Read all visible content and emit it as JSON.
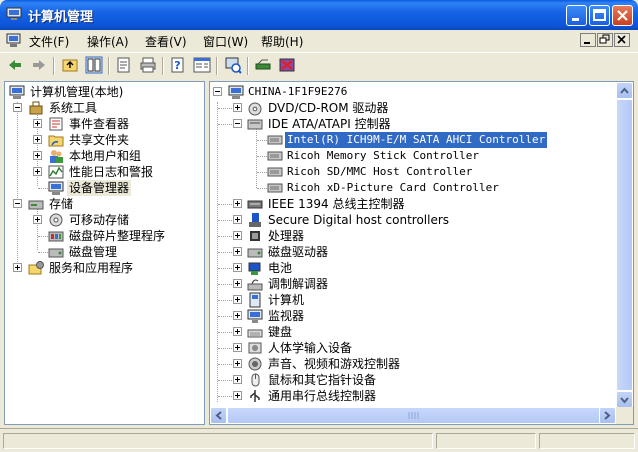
{
  "window": {
    "title": "计算机管理"
  },
  "menu": {
    "items": [
      "文件(F)",
      "操作(A)",
      "查看(V)",
      "窗口(W)",
      "帮助(H)"
    ]
  },
  "toolbar": {
    "icons": [
      "back-icon",
      "forward-icon",
      "up-folder-icon",
      "show-hide-tree-icon",
      "properties-icon",
      "print-icon",
      "help-icon",
      "show-console-icon",
      "scan-hardware-icon",
      "update-driver-icon",
      "disable-device-icon"
    ]
  },
  "left_tree": {
    "root": "计算机管理(本地)",
    "system_tools": "系统工具",
    "event_viewer": "事件查看器",
    "shared_folders": "共享文件夹",
    "local_users": "本地用户和组",
    "perf_logs": "性能日志和警报",
    "device_manager": "设备管理器",
    "storage": "存储",
    "removable_storage": "可移动存储",
    "defrag": "磁盘碎片整理程序",
    "disk_mgmt": "磁盘管理",
    "services": "服务和应用程序"
  },
  "right_tree": {
    "root": "CHINA-1F1F9E276",
    "items": [
      {
        "label": "DVD/CD-ROM 驱动器",
        "icon": "dvd-drive-icon",
        "level": 1,
        "expander": "plus"
      },
      {
        "label": "IDE ATA/ATAPI 控制器",
        "icon": "ide-controller-icon",
        "level": 1,
        "expander": "minus"
      },
      {
        "label": "Intel(R) ICH9M-E/M SATA AHCI Controller",
        "icon": "controller-card-icon",
        "level": 2,
        "selected": true
      },
      {
        "label": "Ricoh Memory Stick Controller",
        "icon": "controller-card-icon",
        "level": 2
      },
      {
        "label": "Ricoh SD/MMC Host Controller",
        "icon": "controller-card-icon",
        "level": 2
      },
      {
        "label": "Ricoh xD-Picture Card Controller",
        "icon": "controller-card-icon",
        "level": 2
      },
      {
        "label": "IEEE 1394 总线主控制器",
        "icon": "ieee1394-icon",
        "level": 1,
        "expander": "plus"
      },
      {
        "label": "Secure Digital host controllers",
        "icon": "sd-host-icon",
        "level": 1,
        "expander": "plus"
      },
      {
        "label": "处理器",
        "icon": "processor-icon",
        "level": 1,
        "expander": "plus"
      },
      {
        "label": "磁盘驱动器",
        "icon": "disk-drive-icon",
        "level": 1,
        "expander": "plus"
      },
      {
        "label": "电池",
        "icon": "battery-icon",
        "level": 1,
        "expander": "plus"
      },
      {
        "label": "调制解调器",
        "icon": "modem-icon",
        "level": 1,
        "expander": "plus"
      },
      {
        "label": "计算机",
        "icon": "computer-icon",
        "level": 1,
        "expander": "plus"
      },
      {
        "label": "监视器",
        "icon": "monitor-icon",
        "level": 1,
        "expander": "plus"
      },
      {
        "label": "键盘",
        "icon": "keyboard-icon",
        "level": 1,
        "expander": "plus"
      },
      {
        "label": "人体学输入设备",
        "icon": "hid-icon",
        "level": 1,
        "expander": "plus"
      },
      {
        "label": "声音、视频和游戏控制器",
        "icon": "sound-icon",
        "level": 1,
        "expander": "plus"
      },
      {
        "label": "鼠标和其它指针设备",
        "icon": "mouse-icon",
        "level": 1,
        "expander": "plus"
      },
      {
        "label": "通用串行总线控制器",
        "icon": "usb-icon",
        "level": 1,
        "expander": "plus"
      }
    ]
  }
}
